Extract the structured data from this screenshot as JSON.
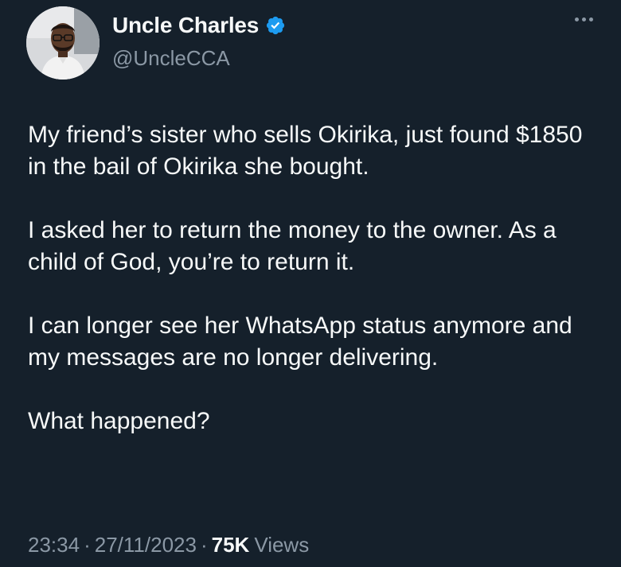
{
  "author": {
    "display_name": "Uncle Charles",
    "handle": "@UncleCCA",
    "verified": true,
    "avatar": "profile-photo"
  },
  "tweet": {
    "paragraphs": [
      "My friend’s sister who sells Okirika, just found $1850 in the bail of Okirika she bought.",
      "I asked her to return the money to the owner. As a child of God, you’re to return it.",
      "I can longer see her WhatsApp status anymore and my messages are no longer delivering.",
      "What happened?"
    ]
  },
  "meta": {
    "time": "23:34",
    "date": "27/11/2023",
    "separator": "·",
    "views_count": "75K",
    "views_label": "Views"
  },
  "colors": {
    "background": "#15202b",
    "text": "#f7f9f9",
    "secondary": "#8b98a5",
    "verified_badge": "#1d9bf0"
  },
  "icons": {
    "verified": "verified-badge-icon",
    "more": "more-options-icon"
  }
}
